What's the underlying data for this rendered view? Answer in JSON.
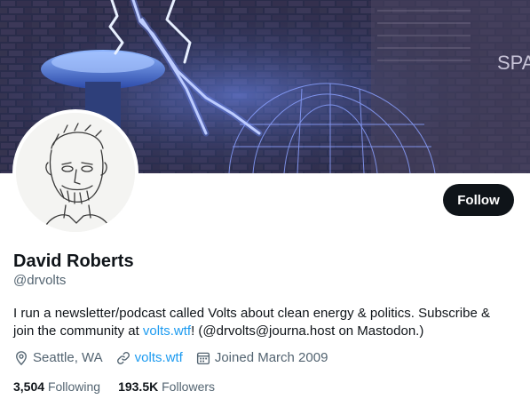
{
  "profile": {
    "display_name": "David Roberts",
    "handle": "@drvolts",
    "bio_pre": "I run a newsletter/podcast called Volts about clean energy & politics. Subscribe & join the community at ",
    "bio_link": "volts.wtf",
    "bio_post": "! (@drvolts@journa.host on Mastodon.)",
    "location": "Seattle, WA",
    "website": "volts.wtf",
    "joined": "Joined March 2009"
  },
  "actions": {
    "follow_label": "Follow"
  },
  "stats": {
    "following_count": "3,504",
    "following_label": "Following",
    "followers_count": "193.5K",
    "followers_label": "Followers"
  },
  "banner": {
    "wall_text": "SPA"
  },
  "icons": {
    "location": "location-pin-icon",
    "website": "link-icon",
    "joined": "calendar-icon"
  },
  "colors": {
    "link": "#1d9bf0",
    "primary_text": "#0f1419",
    "secondary_text": "#536471",
    "button_bg": "#0f1419"
  }
}
